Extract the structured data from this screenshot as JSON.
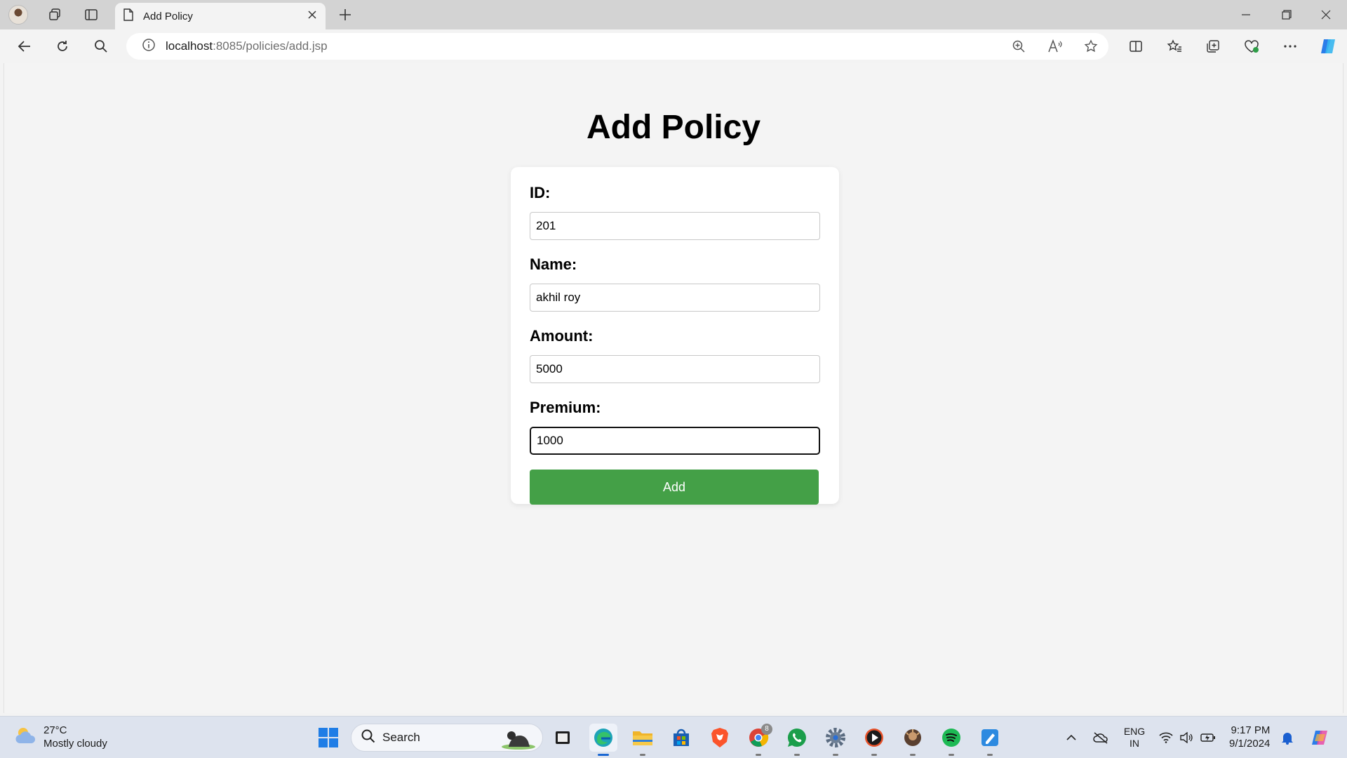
{
  "browser": {
    "tab_title": "Add Policy",
    "url_host": "localhost",
    "url_path": ":8085/policies/add.jsp"
  },
  "page": {
    "title": "Add Policy",
    "fields": {
      "id": {
        "label": "ID:",
        "value": "201"
      },
      "name": {
        "label": "Name:",
        "value": "akhil roy"
      },
      "amount": {
        "label": "Amount:",
        "value": "5000"
      },
      "premium": {
        "label": "Premium:",
        "value": "1000"
      }
    },
    "submit_label": "Add",
    "colors": {
      "button": "#44a047",
      "background": "#f4f4f4",
      "card": "#ffffff"
    }
  },
  "taskbar": {
    "weather_temp": "27°C",
    "weather_desc": "Mostly cloudy",
    "search_placeholder": "Search",
    "lang_top": "ENG",
    "lang_bottom": "IN",
    "time": "9:17 PM",
    "date": "9/1/2024",
    "chrome_badge": "8"
  }
}
